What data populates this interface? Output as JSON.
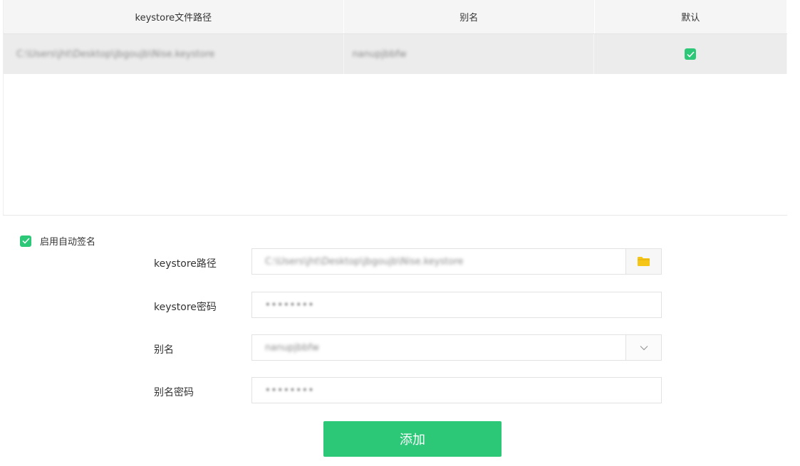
{
  "table": {
    "headers": [
      "keystore文件路径",
      "别名",
      "默认"
    ],
    "rows": [
      {
        "path": "C:\\Users\\jht\\Desktop\\jbgoujb\\Nise.keystore",
        "alias": "nanupjbbfw",
        "default": true
      }
    ]
  },
  "auto_sign": {
    "label": "启用自动签名",
    "checked": true
  },
  "form": {
    "keystore_path_label": "keystore路径",
    "keystore_path_value": "C:\\Users\\jht\\Desktop\\jbgoujb\\Nise.keystore",
    "keystore_password_label": "keystore密码",
    "keystore_password_value": "••••••••",
    "alias_label": "别名",
    "alias_value": "nanupjbbfw",
    "alias_password_label": "别名密码",
    "alias_password_value": "••••••••"
  },
  "add_button_label": "添加",
  "colors": {
    "accent": "#2cc878",
    "folder": "#f5c518"
  }
}
